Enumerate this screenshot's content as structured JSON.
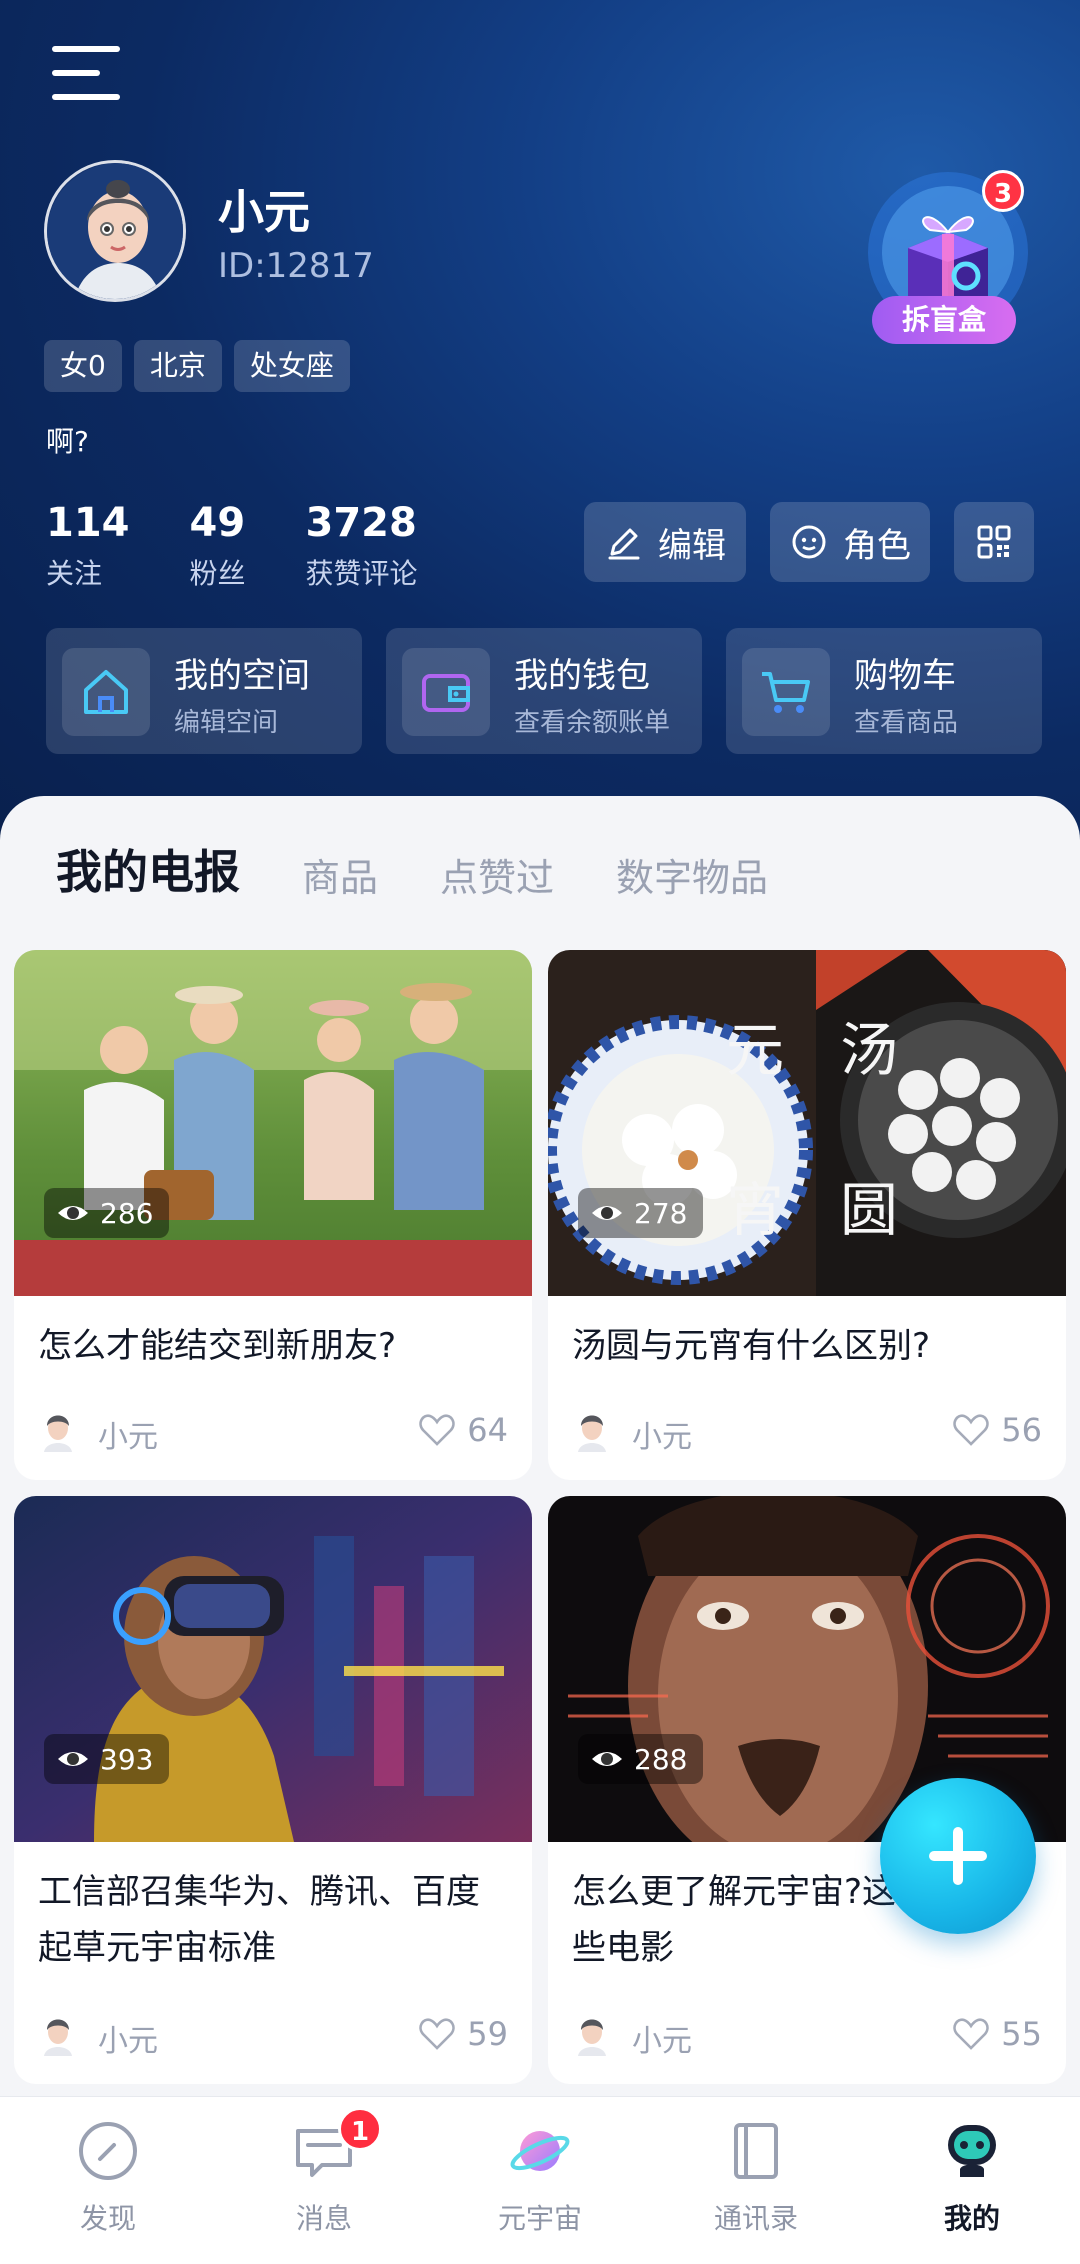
{
  "profile": {
    "name": "小元",
    "id_text": "ID:12817",
    "tags": [
      "女0",
      "北京",
      "处女座"
    ],
    "bio": "啊?",
    "blindbox": {
      "label": "拆盲盒",
      "badge": "3"
    }
  },
  "stats": [
    {
      "value": "114",
      "label": "关注"
    },
    {
      "value": "49",
      "label": "粉丝"
    },
    {
      "value": "3728",
      "label": "获赞评论"
    }
  ],
  "actions": {
    "edit": "编辑",
    "role": "角色",
    "qr_icon": "qrcode-icon"
  },
  "quick_cards": [
    {
      "title": "我的空间",
      "subtitle": "编辑空间",
      "icon": "home-icon"
    },
    {
      "title": "我的钱包",
      "subtitle": "查看余额账单",
      "icon": "wallet-icon"
    },
    {
      "title": "购物车",
      "subtitle": "查看商品",
      "icon": "cart-icon"
    }
  ],
  "tabs": [
    "我的电报",
    "商品",
    "点赞过",
    "数字物品"
  ],
  "posts": [
    {
      "title": "怎么才能结交到新朋友?",
      "views": "286",
      "author": "小元",
      "likes": "64"
    },
    {
      "title": "汤圆与元宵有什么区别?",
      "views": "278",
      "author": "小元",
      "likes": "56",
      "image_text": [
        "元",
        "宵",
        "汤",
        "圆"
      ]
    },
    {
      "title": "工信部召集华为、腾讯、百度起草元宇宙标准",
      "views": "393",
      "author": "小元",
      "likes": "59"
    },
    {
      "title": "怎么更了解元宇宙?这些电影",
      "views": "288",
      "author": "小元",
      "likes": "55"
    }
  ],
  "nav": {
    "items": [
      "发现",
      "消息",
      "元宇宙",
      "通讯录",
      "我的"
    ],
    "message_badge": "1",
    "active": "我的"
  },
  "colors": {
    "accent": "#1ec2ee",
    "header_bg": "#0c2a62",
    "badge": "#ff2d3f"
  }
}
